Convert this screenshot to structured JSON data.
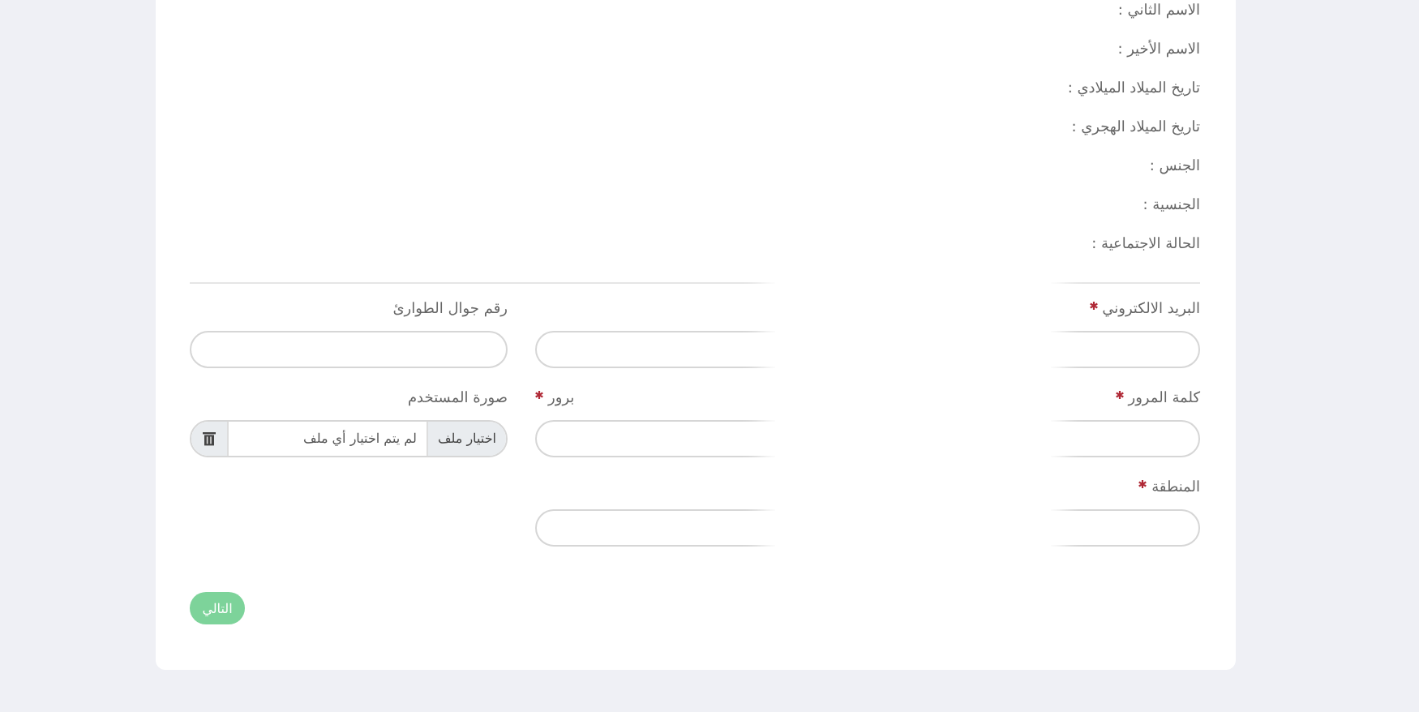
{
  "profile_labels": [
    "الاسم الثاني :",
    "الاسم الأخير :",
    "تاريخ الميلاد الميلادي :",
    "تاريخ الميلاد الهجري :",
    "الجنس :",
    "الجنسية :",
    "الحالة الاجتماعية :"
  ],
  "account_fields": [
    {
      "label": "البريد الالكتروني",
      "required": true
    },
    {
      "label": "كلمة المرور",
      "required": true,
      "partner_label": "برور",
      "partner_required": true
    },
    {
      "label": "المنطقة",
      "required": true
    }
  ],
  "side_fields": [
    {
      "kind": "text",
      "label": "رقم جوال الطوارئ"
    },
    {
      "kind": "file",
      "label": "صورة المستخدم",
      "button": "اختيار ملف",
      "placeholder": "لم يتم اختيار أي ملف"
    }
  ],
  "next_button": "التالي"
}
